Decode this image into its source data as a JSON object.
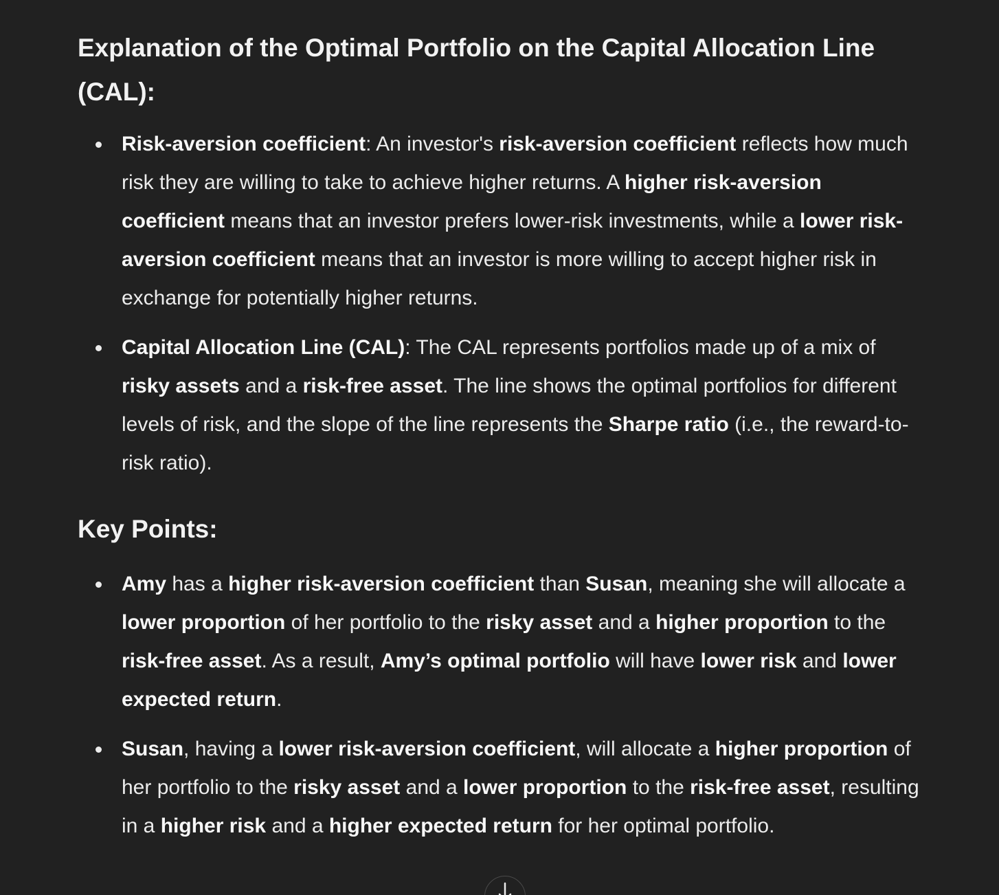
{
  "section1": {
    "title": "Explanation of the Optimal Portfolio on the Capital Allocation Line (CAL):",
    "bullets": [
      {
        "parts": [
          {
            "text": "Risk-aversion coefficient",
            "bold": true
          },
          {
            "text": ": An investor's ",
            "bold": false
          },
          {
            "text": "risk-aversion coefficient",
            "bold": true
          },
          {
            "text": " reflects how much risk they are willing to take to achieve higher returns. A ",
            "bold": false
          },
          {
            "text": "higher risk-aversion coefficient",
            "bold": true
          },
          {
            "text": " means that an investor prefers lower-risk investments, while a ",
            "bold": false
          },
          {
            "text": "lower risk-aversion coefficient",
            "bold": true
          },
          {
            "text": " means that an investor is more willing to accept higher risk in exchange for potentially higher returns.",
            "bold": false
          }
        ]
      },
      {
        "parts": [
          {
            "text": "Capital Allocation Line (CAL)",
            "bold": true
          },
          {
            "text": ": The CAL represents portfolios made up of a mix of ",
            "bold": false
          },
          {
            "text": "risky assets",
            "bold": true
          },
          {
            "text": " and a ",
            "bold": false
          },
          {
            "text": "risk-free asset",
            "bold": true
          },
          {
            "text": ". The line shows the optimal portfolios for different levels of risk, and the slope of the line represents the ",
            "bold": false
          },
          {
            "text": "Sharpe ratio",
            "bold": true
          },
          {
            "text": " (i.e., the reward-to-risk ratio).",
            "bold": false
          }
        ]
      }
    ]
  },
  "section2": {
    "title": "Key Points:",
    "bullets": [
      {
        "parts": [
          {
            "text": "Amy",
            "bold": true
          },
          {
            "text": " has a ",
            "bold": false
          },
          {
            "text": "higher risk-aversion coefficient",
            "bold": true
          },
          {
            "text": " than ",
            "bold": false
          },
          {
            "text": "Susan",
            "bold": true
          },
          {
            "text": ", meaning she will allocate a ",
            "bold": false
          },
          {
            "text": "lower proportion",
            "bold": true
          },
          {
            "text": " of her portfolio to the ",
            "bold": false
          },
          {
            "text": "risky asset",
            "bold": true
          },
          {
            "text": " and a ",
            "bold": false
          },
          {
            "text": "higher proportion",
            "bold": true
          },
          {
            "text": " to the ",
            "bold": false
          },
          {
            "text": "risk-free asset",
            "bold": true
          },
          {
            "text": ". As a result, ",
            "bold": false
          },
          {
            "text": "Amy’s optimal portfolio",
            "bold": true
          },
          {
            "text": " will have ",
            "bold": false
          },
          {
            "text": "lower risk",
            "bold": true
          },
          {
            "text": " and ",
            "bold": false
          },
          {
            "text": "lower expected return",
            "bold": true
          },
          {
            "text": ".",
            "bold": false
          }
        ]
      },
      {
        "parts": [
          {
            "text": "Susan",
            "bold": true
          },
          {
            "text": ", having a ",
            "bold": false
          },
          {
            "text": "lower risk-aversion coefficient",
            "bold": true
          },
          {
            "text": ", will allocate a ",
            "bold": false
          },
          {
            "text": "higher proportion",
            "bold": true
          },
          {
            "text": " of her portfolio to the ",
            "bold": false
          },
          {
            "text": "risky asset",
            "bold": true
          },
          {
            "text": " and a ",
            "bold": false
          },
          {
            "text": "lower proportion",
            "bold": true
          },
          {
            "text": " to the ",
            "bold": false
          },
          {
            "text": "risk-free asset",
            "bold": true
          },
          {
            "text": ", resulting in a ",
            "bold": false
          },
          {
            "text": "higher risk",
            "bold": true
          },
          {
            "text": " and a ",
            "bold": false
          },
          {
            "text": "higher expected return",
            "bold": true
          },
          {
            "text": " for her optimal portfolio.",
            "bold": false
          }
        ]
      }
    ]
  },
  "scroll_button": {
    "icon": "arrow-down-icon"
  }
}
